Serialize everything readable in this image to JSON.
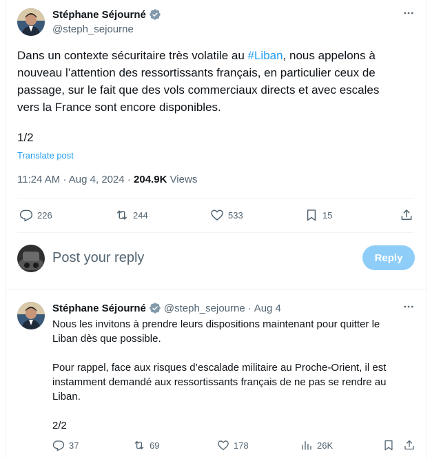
{
  "tweet": {
    "author": {
      "display_name": "Stéphane Séjourné",
      "handle": "@steph_sejourne"
    },
    "text_before_hashtag": "Dans un contexte sécuritaire très volatile au ",
    "hashtag": "#Liban",
    "text_after_hashtag": ", nous appelons à nouveau l’attention des ressortissants français, en particulier ceux de passage, sur le fait que des vols commerciaux directs et avec escales vers la France sont encore disponibles.",
    "page_marker": "1/2",
    "translate_label": "Translate post",
    "time": "11:24 AM",
    "separator": "·",
    "date": "Aug 4, 2024",
    "views_count": "204.9K",
    "views_label": "Views",
    "actions": {
      "replies": "226",
      "reposts": "244",
      "likes": "533",
      "bookmarks": "15"
    }
  },
  "reply_composer": {
    "placeholder": "Post your reply",
    "button_label": "Reply"
  },
  "thread_tweet": {
    "display_name": "Stéphane Séjourné",
    "handle": "@steph_sejourne",
    "separator": "·",
    "date": "Aug 4",
    "paragraph_1": "Nous les invitons à prendre leurs dispositions maintenant pour quitter le Liban dès que possible.",
    "paragraph_2": "Pour rappel, face aux risques d’escalade militaire au Proche-Orient, il est instamment demandé aux ressortissants français de ne pas se rendre au Liban.",
    "page_marker": "2/2",
    "actions": {
      "replies": "37",
      "reposts": "69",
      "likes": "178",
      "views": "26K"
    }
  },
  "colors": {
    "accent": "#1d9bf0",
    "reply_button_disabled": "#8ecdf8",
    "secondary_text": "#536471",
    "divider": "#eff3f4"
  },
  "icons": [
    "verified-badge-icon",
    "more-icon",
    "reply-icon",
    "repost-icon",
    "like-icon",
    "bookmark-icon",
    "share-icon",
    "views-icon"
  ]
}
